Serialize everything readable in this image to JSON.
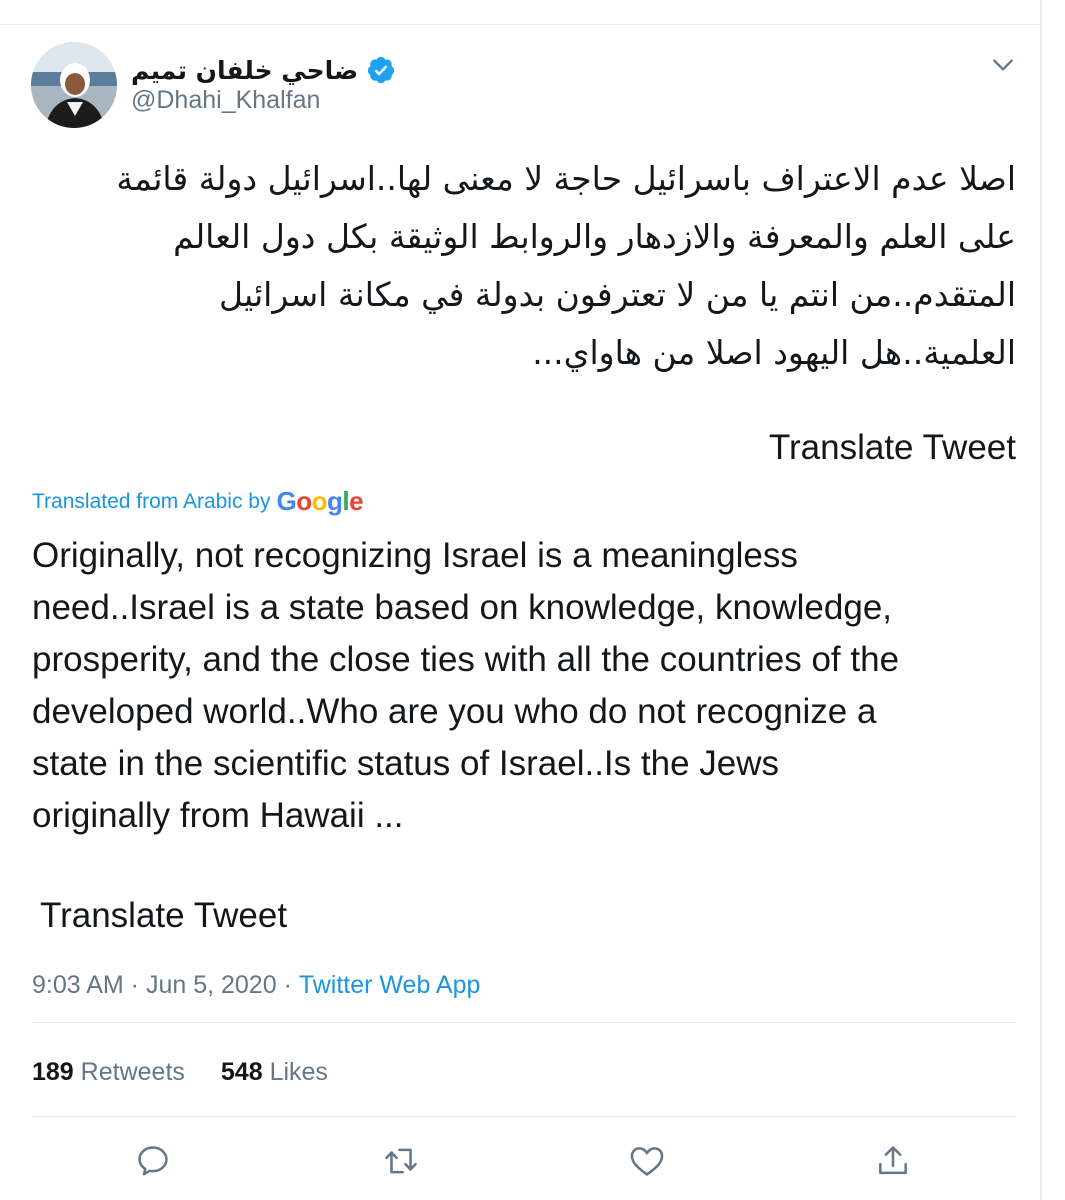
{
  "user": {
    "display_name": "ضاحي خلفان تميم",
    "handle": "@Dhahi_Khalfan",
    "verified": true
  },
  "tweet": {
    "arabic_lines": [
      "اصلا عدم الاعتراف باسرائيل حاجة لا معنى لها..اسرائيل دولة قائمة",
      "على العلم والمعرفة والازدهار والروابط الوثيقة بكل دول العالم",
      "المتقدم..من انتم يا من لا تعترفون بدولة في مكانة اسرائيل",
      "العلمية..هل اليهود اصلا من هاواي..."
    ],
    "translate_label_top": "Translate Tweet",
    "translated_from": "Translated from Arabic by",
    "google_letters": [
      "G",
      "o",
      "o",
      "g",
      "l",
      "e"
    ],
    "english_lines": [
      "Originally, not recognizing Israel is a meaningless",
      "need..Israel is a state based on knowledge, knowledge,",
      "prosperity, and the close ties with all the countries of the",
      "developed world..Who are you who do not recognize a",
      "state in the scientific status of Israel..Is the Jews",
      "originally from Hawaii ..."
    ],
    "translate_label_bottom": "Translate Tweet"
  },
  "meta": {
    "time": "9:03 AM",
    "separator": " · ",
    "date": "Jun 5, 2020",
    "source": "Twitter Web App"
  },
  "stats": {
    "retweets_count": "189",
    "retweets_label": "Retweets",
    "likes_count": "548",
    "likes_label": "Likes"
  },
  "icons": {
    "verified": "verified-badge-icon",
    "caret": "chevron-down-icon",
    "reply": "reply-icon",
    "retweet": "retweet-icon",
    "like": "heart-icon",
    "share": "share-icon"
  },
  "colors": {
    "accent": "#1b95e0",
    "muted": "#657786",
    "text": "#14171a",
    "verified": "#1da1f2",
    "google_blue": "#4285f4",
    "google_red": "#ea4335",
    "google_yellow": "#fbbc05",
    "google_green": "#34a853"
  }
}
